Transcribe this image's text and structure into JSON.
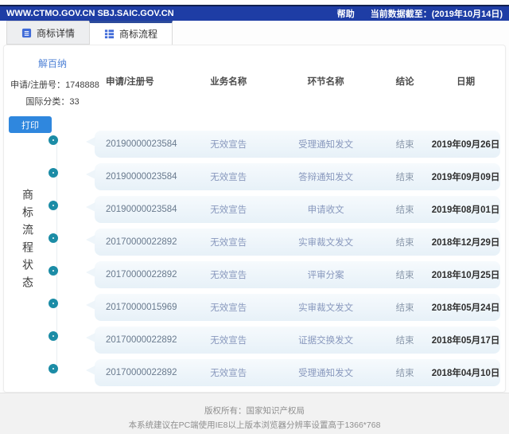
{
  "topbar": {
    "urls": "WWW.CTMO.GOV.CN SBJ.SAIC.GOV.CN",
    "help": "帮助",
    "data_cutoff": "当前数据截至：(2019年10月14日)"
  },
  "tabs": [
    {
      "label": "商标详情"
    },
    {
      "label": "商标流程"
    }
  ],
  "trademark": {
    "name": "解百纳",
    "reg_label": "申请/注册号：",
    "reg_value": "1748888",
    "class_label": "国际分类：",
    "class_value": "33"
  },
  "print_button": "打印",
  "side_label": "商标流程状态",
  "table": {
    "headers": [
      "申请/注册号",
      "业务名称",
      "环节名称",
      "结论",
      "日期"
    ],
    "rows": [
      {
        "reg_no": "20190000023584",
        "business": "无效宣告",
        "step": "受理通知发文",
        "conclusion": "结束",
        "date": "2019年09月26日"
      },
      {
        "reg_no": "20190000023584",
        "business": "无效宣告",
        "step": "答辩通知发文",
        "conclusion": "结束",
        "date": "2019年09月09日"
      },
      {
        "reg_no": "20190000023584",
        "business": "无效宣告",
        "step": "申请收文",
        "conclusion": "结束",
        "date": "2019年08月01日"
      },
      {
        "reg_no": "20170000022892",
        "business": "无效宣告",
        "step": "实审裁文发文",
        "conclusion": "结束",
        "date": "2018年12月29日"
      },
      {
        "reg_no": "20170000022892",
        "business": "无效宣告",
        "step": "评审分案",
        "conclusion": "结束",
        "date": "2018年10月25日"
      },
      {
        "reg_no": "20170000015969",
        "business": "无效宣告",
        "step": "实审裁文发文",
        "conclusion": "结束",
        "date": "2018年05月24日"
      },
      {
        "reg_no": "20170000022892",
        "business": "无效宣告",
        "step": "证据交换发文",
        "conclusion": "结束",
        "date": "2018年05月17日"
      },
      {
        "reg_no": "20170000022892",
        "business": "无效宣告",
        "step": "受理通知发文",
        "conclusion": "结束",
        "date": "2018年04月10日"
      }
    ]
  },
  "footer": {
    "line1": "版权所有：国家知识产权局",
    "line2": "本系统建议在PC端使用IE8以上版本浏览器分辨率设置高于1366*768"
  },
  "colors": {
    "topbar_blue": "#1e3da5",
    "accent_blue": "#2f87de",
    "tab_icon_blue": "#3f6ad8",
    "timeline_teal": "#1b8ca6",
    "bubble_blue": "#e7f1f8",
    "trademark_name_blue": "#4f82d6"
  }
}
